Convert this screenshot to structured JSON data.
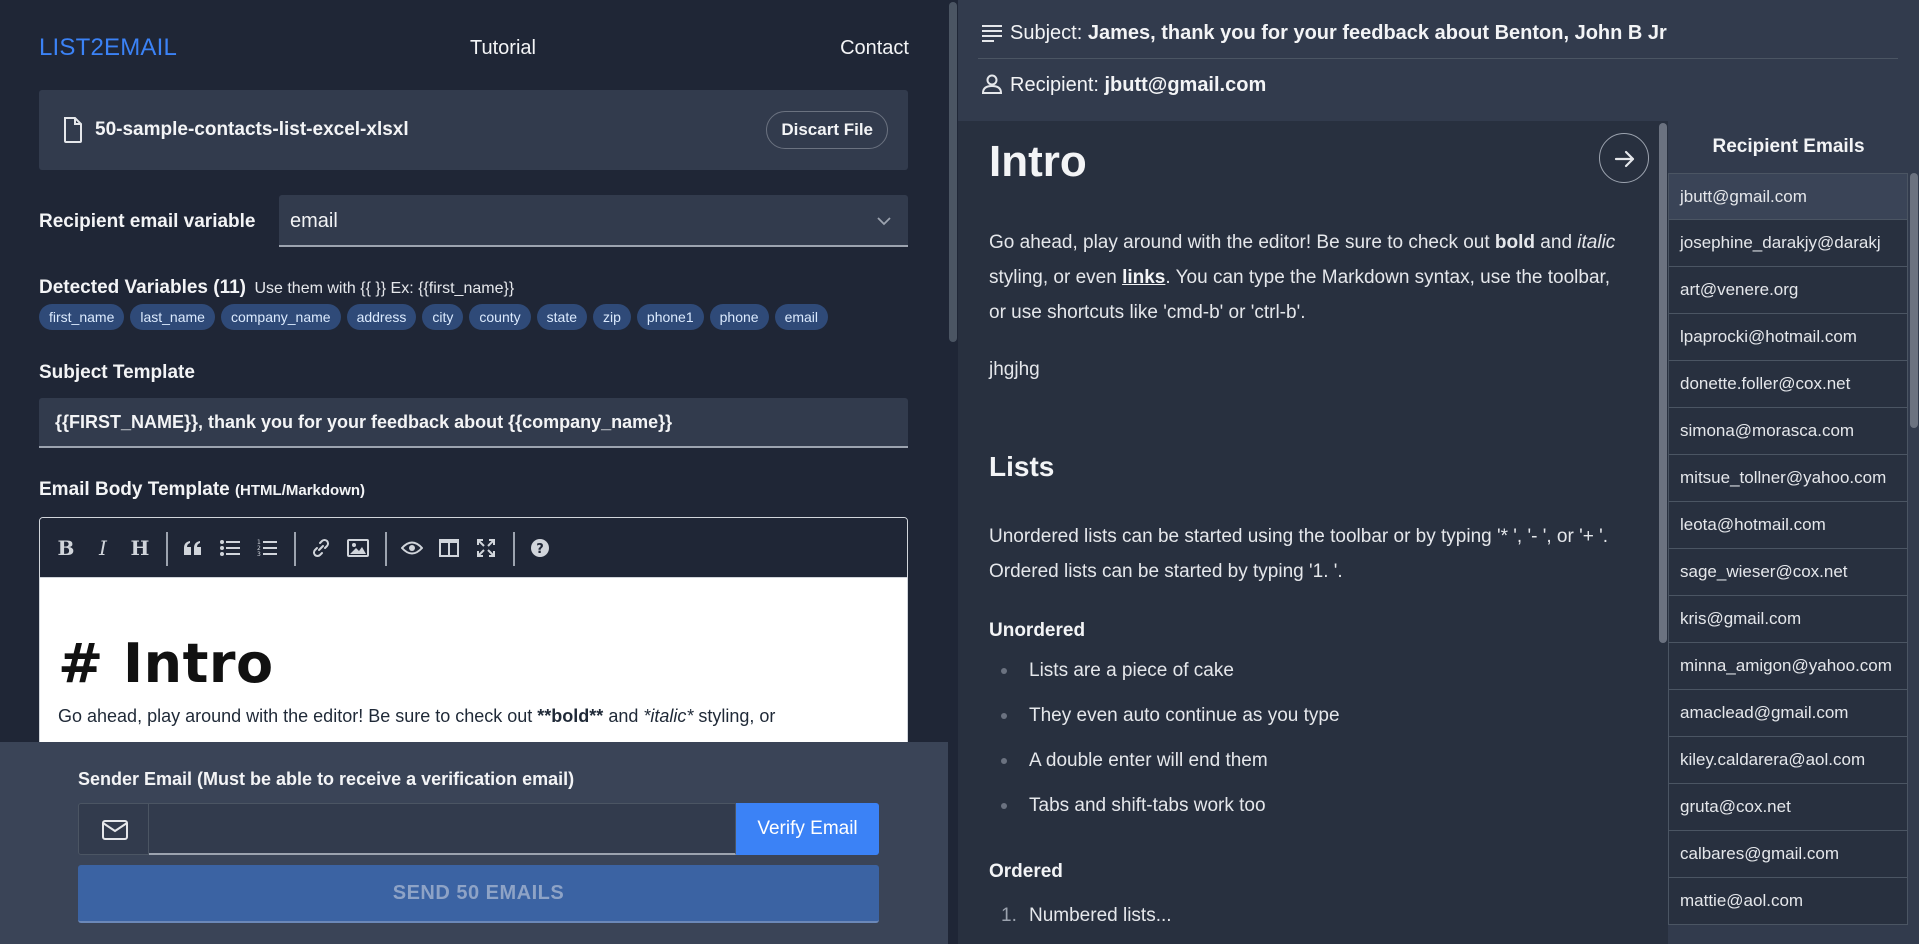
{
  "nav": {
    "brand": "LIST2EMAIL",
    "tutorial": "Tutorial",
    "contact": "Contact"
  },
  "file": {
    "name": "50-sample-contacts-list-excel-xlsxl",
    "discard_label": "Discart File",
    "icon": "file-icon"
  },
  "recipient_variable": {
    "label": "Recipient email variable",
    "selected": "email",
    "icon": "chevron-down-icon"
  },
  "detected": {
    "title": "Detected Variables (11)",
    "hint": "Use them with {{ }} Ex: {{first_name}}",
    "variables": [
      "first_name",
      "last_name",
      "company_name",
      "address",
      "city",
      "county",
      "state",
      "zip",
      "phone1",
      "phone",
      "email"
    ]
  },
  "subject_template": {
    "label": "Subject Template",
    "value": "{{FIRST_NAME}}, thank you for your feedback about {{company_name}}"
  },
  "body_template": {
    "label": "Email Body Template",
    "label_suffix": "(HTML/Markdown)",
    "toolbar": [
      "bold-icon",
      "italic-icon",
      "heading-icon",
      "quote-icon",
      "unordered-list-icon",
      "ordered-list-icon",
      "link-icon",
      "image-icon",
      "preview-icon",
      "side-by-side-icon",
      "fullscreen-icon",
      "help-icon"
    ],
    "heading": "# Intro",
    "paragraph_prefix": "Go ahead, play around with the editor! Be sure to check out ",
    "paragraph_bold": "**bold**",
    "paragraph_and": " and ",
    "paragraph_italic": "*italic*",
    "paragraph_suffix": " styling, or"
  },
  "sender": {
    "label": "Sender Email (Must be able to receive a verification email)",
    "input_value": "",
    "verify_label": "Verify Email",
    "send_label": "SEND 50 EMAILS",
    "icon": "mail-icon"
  },
  "preview_header": {
    "subject_label": "Subject:",
    "subject_value": "James, thank you for your feedback about Benton, John B Jr",
    "recipient_label": "Recipient:",
    "recipient_value": "jbutt@gmail.com"
  },
  "preview": {
    "h1": "Intro",
    "p1_a": "Go ahead, play around with the editor! Be sure to check out ",
    "p1_bold": "bold",
    "p1_b": " and ",
    "p1_italic": "italic",
    "p1_c": " styling, or even ",
    "p1_link": "links",
    "p1_d": ". You can type the Markdown syntax, use the toolbar, or use shortcuts like 'cmd-b' or 'ctrl-b'.",
    "p2": "jhgjhg",
    "h2": "Lists",
    "p3": "Unordered lists can be started using the toolbar or by typing '* ', '- ', or '+ '. Ordered lists can be started by typing '1. '.",
    "unordered_title": "Unordered",
    "unordered_items": [
      "Lists are a piece of cake",
      "They even auto continue as you type",
      "A double enter will end them",
      "Tabs and shift-tabs work too"
    ],
    "ordered_title": "Ordered",
    "ordered_items": [
      {
        "num": "1.",
        "text": "Numbered lists..."
      }
    ]
  },
  "recipients": {
    "title": "Recipient Emails",
    "emails": [
      "jbutt@gmail.com",
      "josephine_darakjy@darakj",
      "art@venere.org",
      "lpaprocki@hotmail.com",
      "donette.foller@cox.net",
      "simona@morasca.com",
      "mitsue_tollner@yahoo.com",
      "leota@hotmail.com",
      "sage_wieser@cox.net",
      "kris@gmail.com",
      "minna_amigon@yahoo.com",
      "amaclead@gmail.com",
      "kiley.caldarera@aol.com",
      "gruta@cox.net",
      "calbares@gmail.com",
      "mattie@aol.com"
    ]
  }
}
